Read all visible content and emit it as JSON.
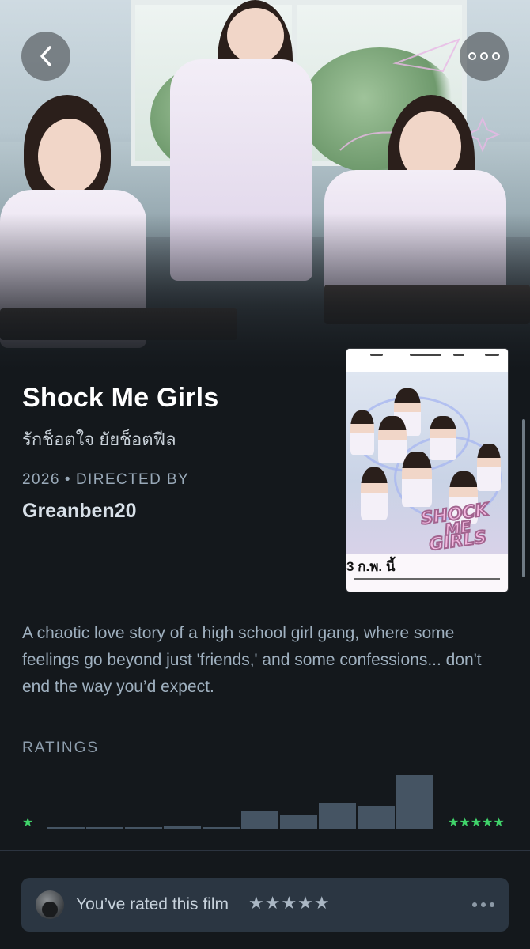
{
  "film": {
    "title": "Shock Me Girls",
    "alt_title": "รักช็อตใจ ยัยช็อตฟีล",
    "year": "2026",
    "directed_by_label": "DIRECTED BY",
    "director": "Greanben20",
    "synopsis": "A chaotic love story of a high school girl gang, where some feelings go beyond just 'friends,' and some confessions... don't end the way you’d expect."
  },
  "poster": {
    "logo_line1": "SHOCK",
    "logo_line2": "ME",
    "logo_line3": "GIRLS",
    "date_text": "3 ก.พ. นี้"
  },
  "ratings": {
    "label": "RATINGS",
    "low_star": "★",
    "high_stars": "★★★★★",
    "histogram": [
      0.02,
      0.02,
      0.02,
      0.06,
      0.02,
      0.32,
      0.25,
      0.49,
      0.42,
      1.0
    ],
    "colors": {
      "star": "#40d36a",
      "bar": "#455463"
    }
  },
  "user_rating": {
    "text": "You’ve rated this film",
    "stars": "★★★★★"
  },
  "icons": {
    "back": "chevron-left-icon",
    "more": "more-horizontal-icon"
  }
}
